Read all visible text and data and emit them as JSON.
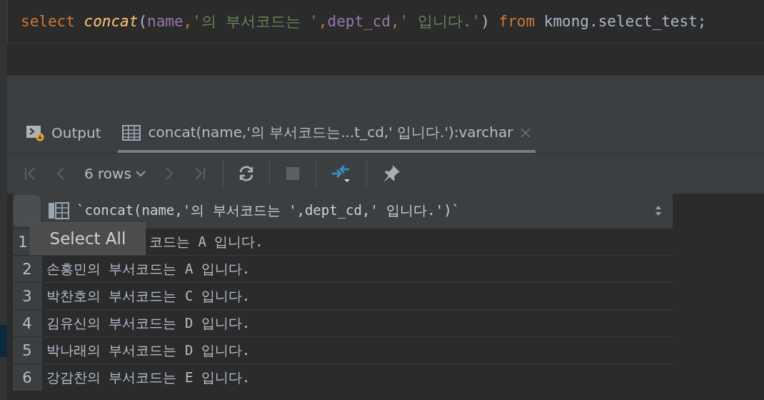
{
  "editor": {
    "tokens": [
      {
        "kind": "keyword",
        "text": "select"
      },
      {
        "kind": "function",
        "text": " concat"
      },
      {
        "kind": "plain",
        "text": "("
      },
      {
        "kind": "column",
        "text": "name"
      },
      {
        "kind": "keyword",
        "text": ","
      },
      {
        "kind": "string",
        "text": "'의 부서코드는 '"
      },
      {
        "kind": "keyword",
        "text": ","
      },
      {
        "kind": "column",
        "text": "dept_cd"
      },
      {
        "kind": "keyword",
        "text": ","
      },
      {
        "kind": "string",
        "text": "' 입니다.'"
      },
      {
        "kind": "plain",
        "text": ") "
      },
      {
        "kind": "keyword",
        "text": "from"
      },
      {
        "kind": "plain",
        "text": " kmong.select_test;"
      }
    ]
  },
  "tabs": [
    {
      "kind": "output",
      "label": "Output",
      "selected": false
    },
    {
      "kind": "table",
      "label": "concat(name,'의 부서코드는...t_cd,' 입니다.'):varchar",
      "selected": true,
      "closable": true
    }
  ],
  "toolbar": {
    "rows_label": "6 rows"
  },
  "grid": {
    "column": "`concat(name,'의 부서코드는 ',dept_cd,' 입니다.')`",
    "tooltip": "Select All",
    "rows": [
      {
        "number": "1",
        "value": "코드는 A 입니다.",
        "covered": true
      },
      {
        "number": "2",
        "value": "손흥민의 부서코드는 A 입니다.",
        "covered": false
      },
      {
        "number": "3",
        "value": "박찬호의 부서코드는 C 입니다.",
        "covered": false
      },
      {
        "number": "4",
        "value": "김유신의 부서코드는 D 입니다.",
        "covered": false
      },
      {
        "number": "5",
        "value": "박나래의 부서코드는 D 입니다.",
        "covered": false
      },
      {
        "number": "6",
        "value": "강감찬의 부서코드는 E 입니다.",
        "covered": false
      }
    ]
  }
}
